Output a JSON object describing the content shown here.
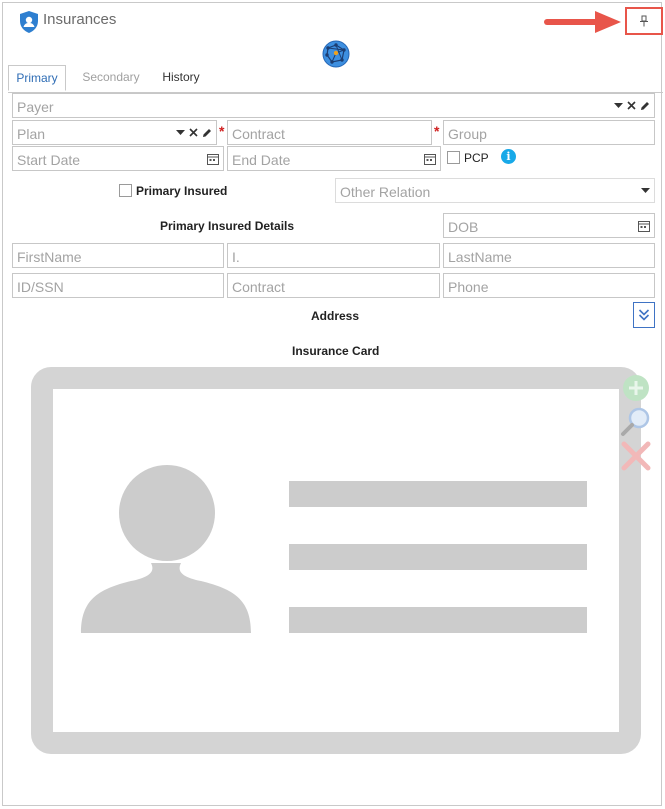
{
  "window": {
    "title": "Insurances"
  },
  "tabs": [
    {
      "label": "Primary",
      "state": "active"
    },
    {
      "label": "Secondary",
      "state": "disabled"
    },
    {
      "label": "History",
      "state": "normal"
    }
  ],
  "fields": {
    "payer": {
      "placeholder": "Payer"
    },
    "plan": {
      "placeholder": "Plan"
    },
    "contract": {
      "placeholder": "Contract",
      "required_mark": "*"
    },
    "group": {
      "placeholder": "Group",
      "required_mark": "*"
    },
    "start_date": {
      "placeholder": "Start Date"
    },
    "end_date": {
      "placeholder": "End Date"
    },
    "pcp": {
      "label": "PCP",
      "checked": false
    },
    "primary_insured": {
      "label": "Primary Insured",
      "checked": false
    },
    "other_relation": {
      "placeholder": "Other Relation"
    }
  },
  "primary_insured_details": {
    "heading": "Primary Insured Details",
    "dob": "DOB",
    "first_name": "FirstName",
    "initial": "I.",
    "last_name": "LastName",
    "id_ssn": "ID/SSN",
    "contract": "Contract",
    "phone": "Phone"
  },
  "address": {
    "heading": "Address"
  },
  "insurance_card": {
    "heading": "Insurance Card"
  },
  "icons": {
    "window": "shield-user-icon",
    "pin": "pin-icon",
    "globe": "globe-network-icon",
    "dropdown": "chevron-down-icon",
    "clear": "close-icon",
    "edit": "pencil-icon",
    "calendar": "calendar-icon",
    "info": "info-icon",
    "expand": "double-chevron-down-icon",
    "add": "add-icon",
    "zoom": "magnifier-icon",
    "remove": "delete-icon"
  },
  "colors": {
    "accent": "#2f6db5",
    "required": "#d01f1f",
    "annotation": "#e8554a",
    "info": "#18a9e8"
  }
}
